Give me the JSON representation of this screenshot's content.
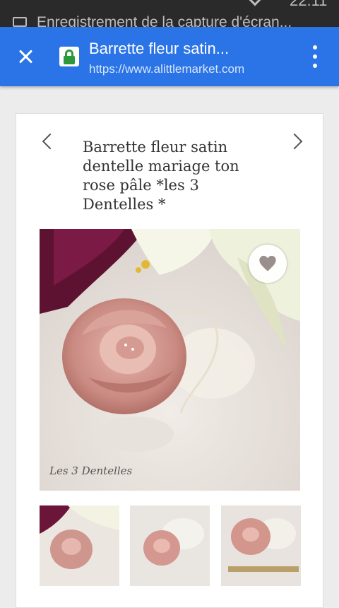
{
  "status_bar": {
    "notification_text": "Enregistrement de la capture d'écran...",
    "time": "22:11"
  },
  "toolbar": {
    "page_title": "Barrette fleur satin...",
    "url": "https://www.alittlemarket.com"
  },
  "product": {
    "title": "Barrette fleur satin dentelle mariage ton rose pâle *les 3 Dentelles *",
    "watermark": "Les 3 Dentelles"
  },
  "icons": {
    "close": "close-icon",
    "lock": "lock-icon",
    "menu": "more-vert-icon",
    "prev": "chevron-left-icon",
    "next": "chevron-right-icon",
    "favorite": "heart-icon"
  },
  "colors": {
    "toolbar": "#2a74e8",
    "lock_green": "#2a9a3a",
    "status_bar": "#2a2a2a"
  }
}
